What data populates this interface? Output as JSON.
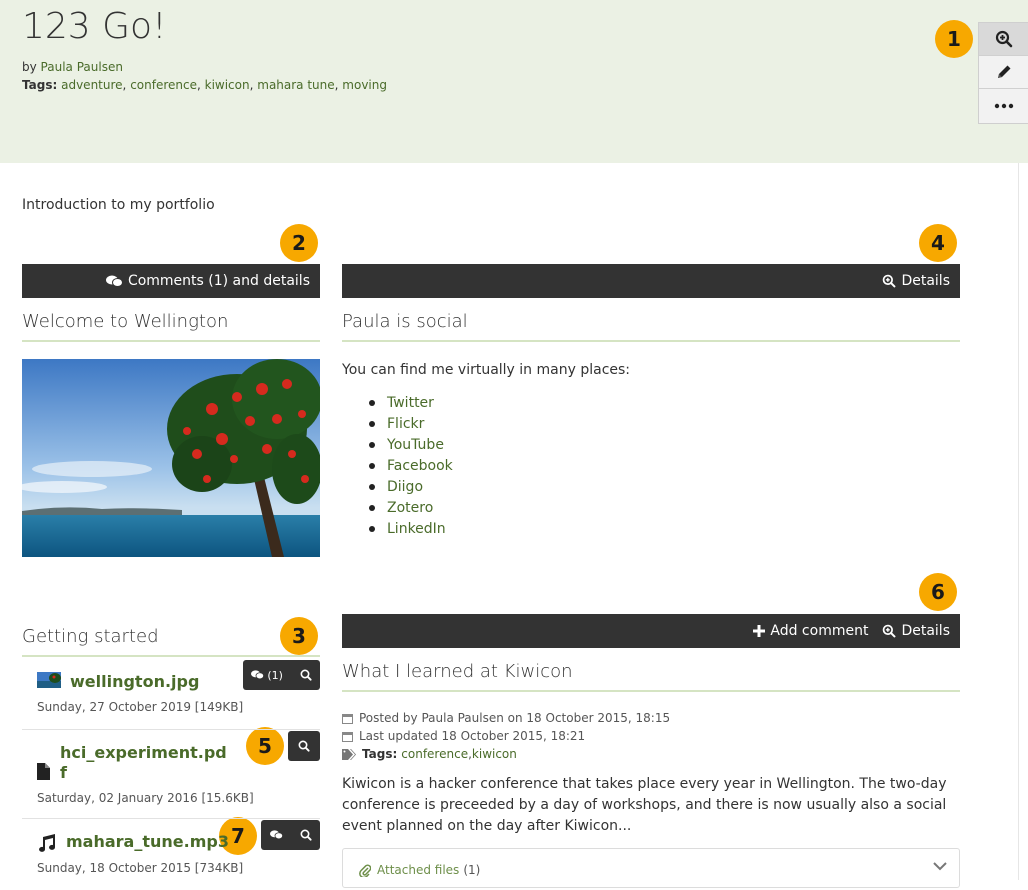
{
  "page": {
    "title": "123 Go!",
    "by_prefix": "by",
    "author": "Paula Paulsen",
    "tags_label": "Tags:",
    "tags": [
      "adventure",
      "conference",
      "kiwicon",
      "mahara tune",
      "moving"
    ],
    "intro": "Introduction to my portfolio"
  },
  "toolbar": {
    "icons": [
      "zoom-in-icon",
      "pencil-icon",
      "more-icon"
    ]
  },
  "badges": [
    "1",
    "2",
    "3",
    "4",
    "5",
    "6",
    "7"
  ],
  "image_block": {
    "bar_label": "Comments (1) and details",
    "title": "Welcome to Wellington"
  },
  "social_block": {
    "bar_label": "Details",
    "title": "Paula is social",
    "intro": "You can find me virtually in many places:",
    "links": [
      "Twitter",
      "Flickr",
      "YouTube",
      "Facebook",
      "Diigo",
      "Zotero",
      "LinkedIn"
    ]
  },
  "files_block": {
    "title": "Getting started",
    "files": [
      {
        "name": "wellington.jpg",
        "meta": "Sunday, 27 October 2019 [149KB]",
        "comments": "(1)"
      },
      {
        "name_line1": "hci_experiment.pd",
        "name_line2": "f",
        "meta": "Saturday, 02 January 2016 [15.6KB]"
      },
      {
        "name": "mahara_tune.mp3",
        "meta": "Sunday, 18 October 2015 [734KB]"
      }
    ]
  },
  "post_block": {
    "add_comment": "Add comment",
    "details": "Details",
    "title": "What I learned at Kiwicon",
    "posted": "Posted by Paula Paulsen on 18 October 2015, 18:15",
    "updated": "Last updated 18 October 2015, 18:21",
    "tags_label": "Tags:",
    "tags": [
      "conference",
      "kiwicon"
    ],
    "body": "Kiwicon is a hacker conference that takes place every year in Wellington. The two-day conference is preceeded by a day of workshops, and there is now usually also a social event planned on the day after Kiwicon...",
    "attached_label": "Attached files",
    "attached_count": "(1)"
  },
  "colors": {
    "accent": "#4a6b2a",
    "header_bg": "#ebf1e4",
    "badge": "#f7a800",
    "dark_bar": "#333333"
  }
}
